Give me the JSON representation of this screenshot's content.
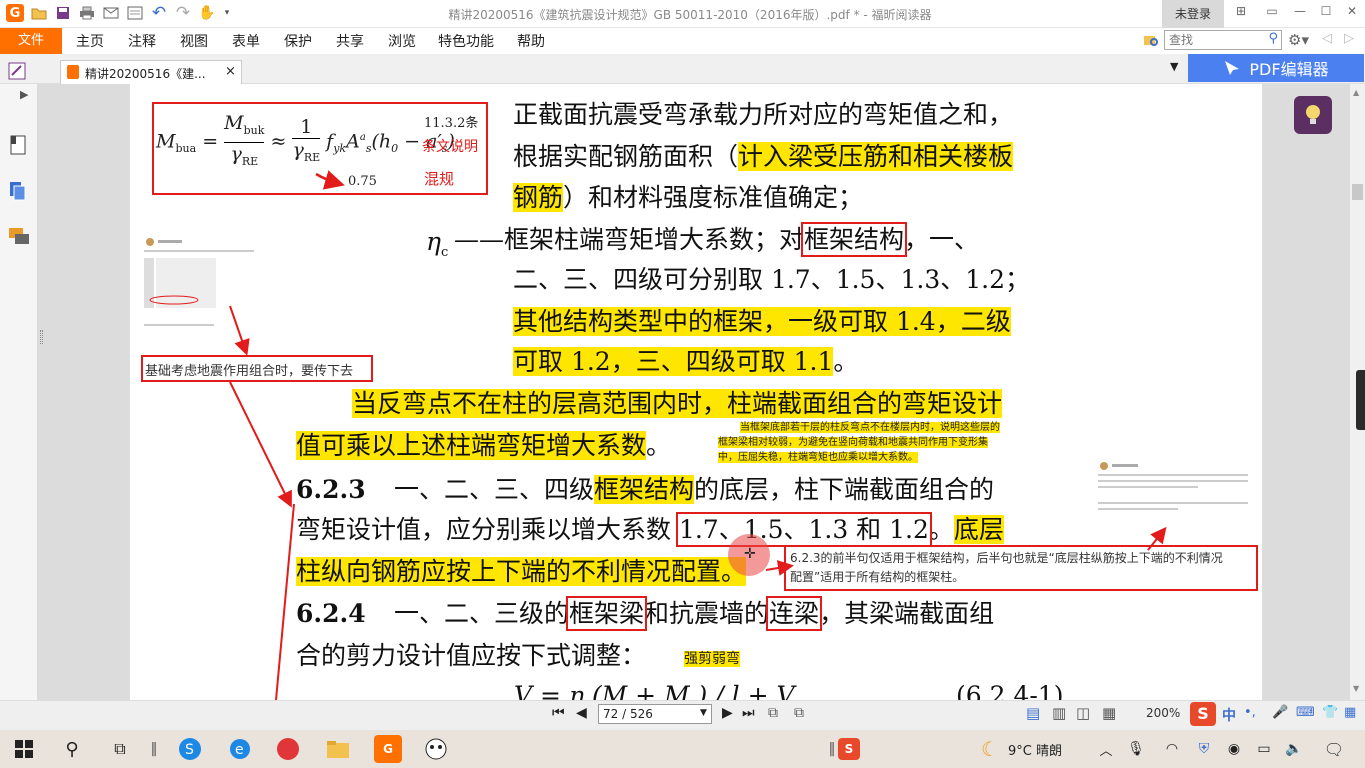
{
  "app": {
    "title": "精讲20200516《建筑抗震设计规范》GB 50011-2010（2016年版）.pdf * - 福昕阅读器",
    "login": "未登录",
    "search_placeholder": "查找"
  },
  "quick_access": [
    "app-logo-icon",
    "open-folder-icon",
    "save-icon",
    "print-icon",
    "mail-icon",
    "undo-icon",
    "redo-icon",
    "hand-tool-icon"
  ],
  "menu": {
    "file": "文件",
    "items": [
      "主页",
      "注释",
      "视图",
      "表单",
      "保护",
      "共享",
      "浏览",
      "特色功能",
      "帮助"
    ]
  },
  "tab": {
    "label": "精讲20200516《建...",
    "close": "×"
  },
  "editor_button": "PDF编辑器",
  "status": {
    "page": "72 / 526",
    "zoom": "200%"
  },
  "taskbar": {
    "weather": "9°C  晴朗",
    "ime": "中"
  },
  "formula": {
    "lhs": "M",
    "lhs_sub": "bua",
    "eq": "=",
    "num": "M",
    "num_sub": "buk",
    "den": "γ",
    "den_sub": "RE",
    "approx": "≈",
    "one": "1",
    "f": "f",
    "f_sub": "yk",
    "A": "A",
    "A_sup": "a",
    "A_sub": "s",
    "tail": "(h",
    "tail_sub": "0",
    "minus": " − a′",
    "minus_sub": "s",
    "close": ")",
    "anno_clause": "11.3.2条",
    "anno_note": "条文说明",
    "anno_mix": "混规",
    "anno_val": "0.75"
  },
  "notes": {
    "pass_down": "基础考虑地震作用组合时，要传下去",
    "bottom_floor_1": "当框架底部若干层的柱反弯点不在楼层内时，说明这些层的",
    "bottom_floor_2": "框架梁相对较弱，为避免在竖向荷载和地震共同作用下变形集",
    "bottom_floor_3": "中，压屈失稳，柱端弯矩也应乘以增大系数。",
    "applies_1": "6.2.3的前半句仅适用于框架结构，后半句也就是“底层柱纵筋按上下端的不利情况",
    "applies_2": "配置”适用于所有结构的框架柱。",
    "strong_shear": "强剪弱弯"
  },
  "text": {
    "l1": "正截面抗震受弯承载力所对应的弯矩值之和，",
    "l2a": "根据实配钢筋面积（",
    "l2b": "计入梁受压筋和相关楼板",
    "l3a": "钢筋",
    "l3b": "）和材料强度标准值确定；",
    "eta": "η",
    "eta_sub": "c",
    "l4a": "——框架柱端弯矩增大系数；对",
    "l4b": "框架结构",
    "l4c": "，一、",
    "l5": "二、三、四级可分别取 1.7、1.5、1.3、1.2；",
    "l6": "其他结构类型中的框架，一级可取 1.4，二级",
    "l7a": "可取 1.2，三、四级可取 1.1",
    "l7b": "。",
    "l8": "当反弯点不在柱的层高范围内时，柱端截面组合的弯矩设计",
    "l9a": "值可乘以上述柱端弯矩增大系数",
    "l9b": "。",
    "c623": "6.2.3",
    "l10a": "一、二、三、四级",
    "l10b": "框架结构",
    "l10c": "的底层，柱下端截面组合的",
    "l11a": "弯矩设计值，应分别乘以增大系数 ",
    "l11b": "1.7、1.5、1.3 和 1.2",
    "l11c": "。",
    "l11d": "底层",
    "l12": "柱纵向钢筋应按上下端的不利情况配置。",
    "c624": "6.2.4",
    "l13a": "一、二、三级的",
    "l13b": "框架梁",
    "l13c": "和抗震墙的",
    "l13d": "连梁",
    "l13e": "，其梁端截面组",
    "l14": "合的剪力设计值应按下式调整：",
    "eq": "V = η  (M  + M ) / l  + V",
    "eq_no": "(6.2.4-1)"
  }
}
